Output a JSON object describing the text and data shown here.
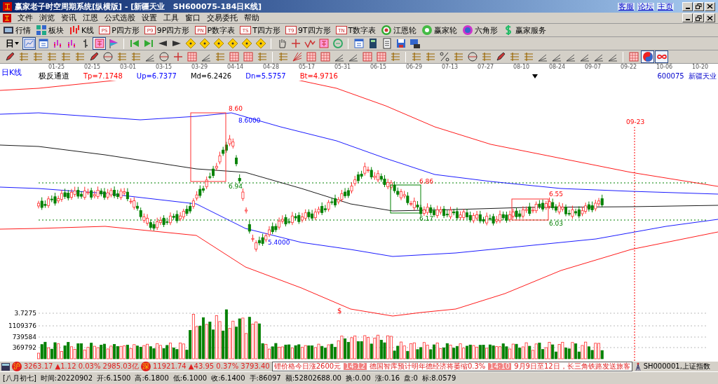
{
  "window": {
    "title": "赢家老子时空周期系统[纵横版] - [新疆天业   SH600075-184日K线]",
    "links": [
      "客服",
      "论坛",
      "主页"
    ]
  },
  "menu": [
    "文件",
    "浏览",
    "资讯",
    "江恩",
    "公式选股",
    "设置",
    "工具",
    "窗口",
    "交易委托",
    "帮助"
  ],
  "toolbar1": [
    {
      "kind": "board",
      "label": "行情"
    },
    {
      "kind": "blocks",
      "label": "板块"
    },
    {
      "kind": "kline",
      "label": "K线"
    },
    {
      "kind": "tag",
      "tag": "PS",
      "label": "P四方形"
    },
    {
      "kind": "tag",
      "tag": "P9",
      "label": "9P四方形"
    },
    {
      "kind": "tag",
      "tag": "PN",
      "label": "P数字表"
    },
    {
      "kind": "tag",
      "tag": "TS",
      "label": "T四方形"
    },
    {
      "kind": "tag",
      "tag": "T9",
      "label": "9T四方形"
    },
    {
      "kind": "tag",
      "tag": "TN",
      "label": "T数字表"
    },
    {
      "kind": "target",
      "label": "江恩轮"
    },
    {
      "kind": "wheel",
      "label": "赢家轮"
    },
    {
      "kind": "hexagon",
      "label": "六角形"
    },
    {
      "kind": "dollar",
      "label": "赢家服务"
    }
  ],
  "toolbar2": {
    "period": "日",
    "buttons": [
      {
        "kind": "chart",
        "selected": true
      },
      {
        "kind": "calendar",
        "selected": false
      },
      {
        "kind": "candles",
        "selected": false
      },
      {
        "kind": "candles",
        "selected": false
      },
      {
        "kind": "bar",
        "selected": false
      },
      {
        "kind": "glyph",
        "selected": true
      },
      {
        "kind": "flag",
        "selected": false
      },
      {
        "kind": "sep"
      },
      {
        "kind": "skip-start",
        "selected": false
      },
      {
        "kind": "skip-end",
        "selected": false
      },
      {
        "kind": "left",
        "selected": false
      },
      {
        "kind": "right",
        "selected": false
      },
      {
        "kind": "diamond",
        "selected": false
      },
      {
        "kind": "diamond",
        "selected": false
      },
      {
        "kind": "diamond",
        "selected": false
      },
      {
        "kind": "diamond",
        "selected": false
      },
      {
        "kind": "diamond",
        "selected": false
      },
      {
        "kind": "diamond",
        "selected": false
      },
      {
        "kind": "sep"
      },
      {
        "kind": "hand",
        "selected": false
      },
      {
        "kind": "plus",
        "selected": false
      },
      {
        "kind": "wave",
        "selected": false
      },
      {
        "kind": "glyph",
        "selected": false
      },
      {
        "kind": "coin",
        "selected": false
      },
      {
        "kind": "sep"
      },
      {
        "kind": "calendar",
        "selected": false
      },
      {
        "kind": "calculator",
        "selected": false
      },
      {
        "kind": "document",
        "selected": false
      },
      {
        "kind": "disk",
        "selected": false
      },
      {
        "kind": "computer",
        "selected": false
      }
    ]
  },
  "toolbar3": [
    {
      "kind": "pen",
      "selected": false
    },
    {
      "kind": "lines",
      "selected": false
    },
    {
      "kind": "lines",
      "selected": false
    },
    {
      "kind": "lines",
      "selected": false
    },
    {
      "kind": "lines",
      "selected": false
    },
    {
      "kind": "lines",
      "selected": false
    },
    {
      "kind": "pen",
      "selected": false
    },
    {
      "kind": "circle",
      "selected": false
    },
    {
      "kind": "lines",
      "selected": false
    },
    {
      "kind": "lines",
      "selected": false
    },
    {
      "kind": "angle",
      "selected": false
    },
    {
      "kind": "circle",
      "selected": false
    },
    {
      "kind": "plus",
      "selected": false
    },
    {
      "kind": "grid",
      "selected": false
    },
    {
      "kind": "angle",
      "selected": false
    },
    {
      "kind": "lines",
      "selected": false
    },
    {
      "kind": "grid",
      "selected": false
    },
    {
      "kind": "grid",
      "selected": false
    },
    {
      "kind": "lines",
      "selected": false
    },
    {
      "kind": "sep"
    },
    {
      "kind": "lines",
      "selected": false
    },
    {
      "kind": "fan",
      "selected": false
    },
    {
      "kind": "grid",
      "selected": false
    },
    {
      "kind": "grid",
      "selected": false
    },
    {
      "kind": "angle",
      "selected": false
    },
    {
      "kind": "angle",
      "selected": false
    },
    {
      "kind": "grid",
      "selected": false
    },
    {
      "kind": "grid",
      "selected": false
    },
    {
      "kind": "lines",
      "selected": false
    },
    {
      "kind": "sep"
    },
    {
      "kind": "lines",
      "selected": false
    },
    {
      "kind": "lines",
      "selected": false
    },
    {
      "kind": "percent",
      "selected": false
    },
    {
      "kind": "lines",
      "selected": false
    },
    {
      "kind": "circle",
      "selected": false
    },
    {
      "kind": "lines",
      "selected": false
    },
    {
      "kind": "pen",
      "selected": false
    },
    {
      "kind": "lines",
      "selected": false
    },
    {
      "kind": "lines",
      "selected": false
    },
    {
      "kind": "angle",
      "selected": false
    },
    {
      "kind": "angle",
      "selected": false
    },
    {
      "kind": "angle",
      "selected": false
    },
    {
      "kind": "angle",
      "selected": false
    },
    {
      "kind": "angle",
      "selected": false
    },
    {
      "kind": "angle",
      "selected": false
    },
    {
      "kind": "sep"
    },
    {
      "kind": "grid",
      "selected": false
    },
    {
      "kind": "yinyang",
      "selected": true
    },
    {
      "kind": "infinity",
      "selected": true
    }
  ],
  "chart": {
    "period_label": "日K线",
    "dates": [
      "01-25",
      "02-15",
      "03-01",
      "03-15",
      "03-29",
      "04-14",
      "04-28",
      "05-17",
      "05-31",
      "06-15",
      "06-29",
      "07-13",
      "07-27",
      "08-10",
      "08-24",
      "09-07",
      "09-22",
      "10-06",
      "10-20"
    ],
    "indicator_name": "极反通道",
    "indicators": [
      {
        "label": "Tp=7.1748",
        "color": "#ff0000"
      },
      {
        "label": "Up=6.7377",
        "color": "#0000ff"
      },
      {
        "label": "Md=6.2426",
        "color": "#000000"
      },
      {
        "label": "Dn=5.5757",
        "color": "#0000ff"
      },
      {
        "label": "Bt=4.9716",
        "color": "#ff0000"
      }
    ],
    "stock": "600075  新疆天业",
    "annotations": [
      {
        "text": "8.60",
        "kind": "high"
      },
      {
        "text": "8.6000",
        "kind": "level"
      },
      {
        "text": "6.94",
        "kind": "low"
      },
      {
        "text": "5.4000",
        "kind": "level"
      },
      {
        "text": "6.86",
        "kind": "high"
      },
      {
        "text": "6.17",
        "kind": "low"
      },
      {
        "text": "6.55",
        "kind": "high"
      },
      {
        "text": "6.03",
        "kind": "low"
      },
      {
        "text": "09-23",
        "kind": "date"
      },
      {
        "text": "$",
        "kind": "mark"
      }
    ],
    "volume_axis": [
      "3.7275",
      "1109376",
      "739584",
      "369792"
    ]
  },
  "ticker": {
    "sh_badge": "沪",
    "sh": "3263.17 ▲1.12 0.03% 2985.03亿",
    "sz_badge": "深",
    "sz": "11921.74 ▲43.95 0.37% 3793.40",
    "news": [
      {
        "text": "锂价格今日涨2600元"
      },
      {
        "time": "14:12",
        "text": "德国智库预计明年德经济将萎缩0.3%"
      },
      {
        "time": "14:10",
        "text": "9月9日至12日，长三角铁路发送旅客"
      }
    ],
    "index": "SH000001,上证指数"
  },
  "status": [
    "[八月初七]",
    "时间:20220902",
    "开:6.1500",
    "高:6.1800",
    "低:6.1000",
    "收:6.1400",
    "手:86097",
    "额:52802688.00",
    "换:0.00",
    "涨:0.16",
    "盘:0",
    "标:8.0579"
  ]
}
